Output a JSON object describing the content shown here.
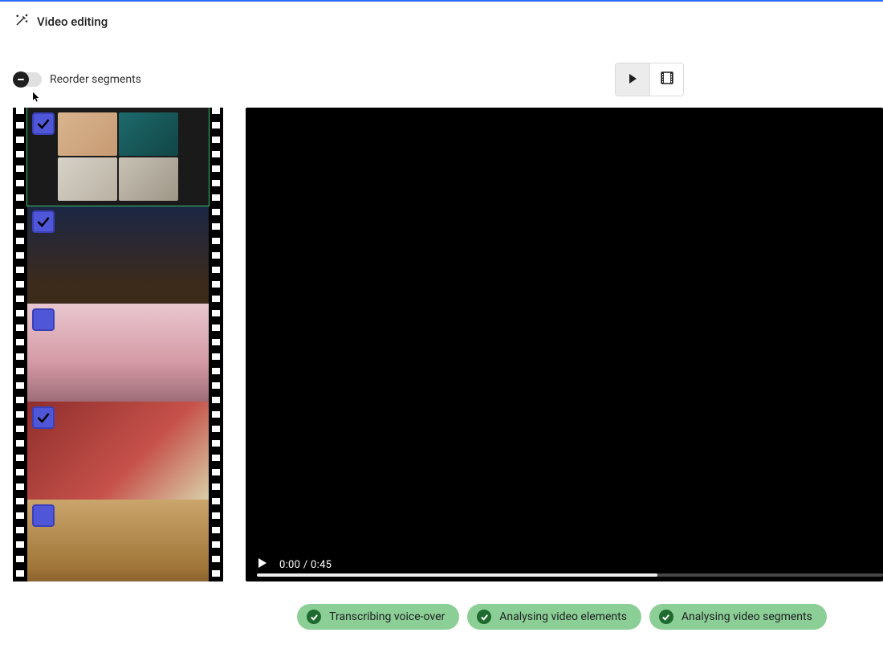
{
  "header": {
    "title": "Video editing"
  },
  "toolbar": {
    "reorder_label": "Reorder segments",
    "reorder_enabled": false,
    "view_mode": "play"
  },
  "filmstrip": {
    "segments": [
      {
        "id": "seg1",
        "checked": true,
        "selected": true
      },
      {
        "id": "seg2",
        "checked": true,
        "selected": false
      },
      {
        "id": "seg3",
        "checked": false,
        "selected": false
      },
      {
        "id": "seg4",
        "checked": true,
        "selected": false
      },
      {
        "id": "seg5",
        "checked": false,
        "selected": false
      }
    ]
  },
  "player": {
    "current_time": "0:00",
    "duration": "0:45",
    "progress_pct": 64
  },
  "status": [
    {
      "label": "Transcribing voice-over",
      "done": true
    },
    {
      "label": "Analysing video elements",
      "done": true
    },
    {
      "label": "Analysing video segments",
      "done": true
    }
  ],
  "icons": {
    "wand": "magic-wand-icon",
    "play": "play-icon",
    "film": "film-icon"
  }
}
